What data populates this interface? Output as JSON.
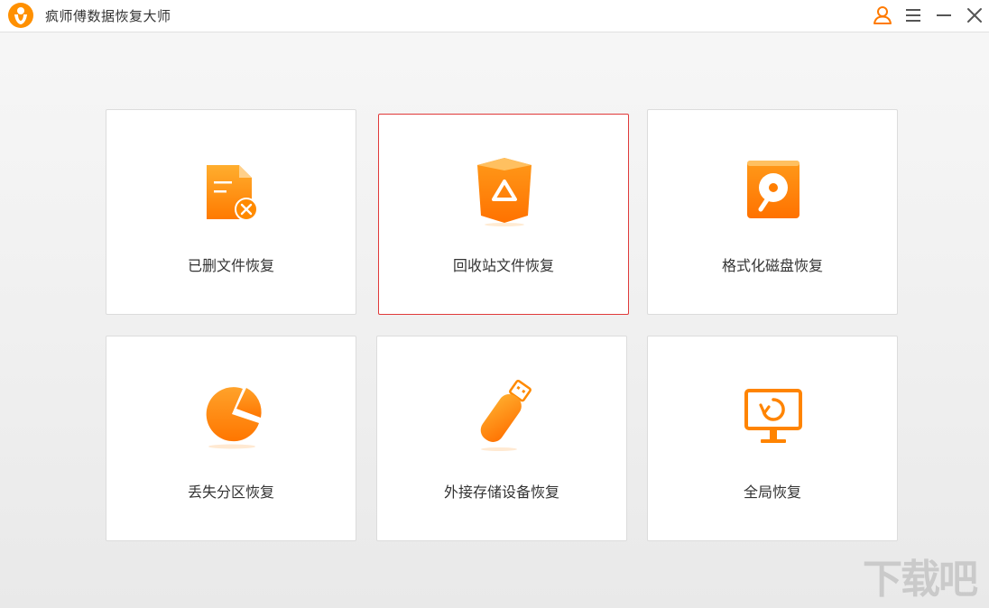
{
  "window": {
    "title": "疯师傅数据恢复大师"
  },
  "titlebar": {
    "account_icon": "user-icon",
    "menu_icon": "hamburger-menu-icon",
    "minimize_icon": "minimize-icon",
    "close_icon": "close-icon"
  },
  "cards": [
    {
      "label": "已删文件恢复",
      "icon": "deleted-file-icon"
    },
    {
      "label": "回收站文件恢复",
      "icon": "recycle-bin-icon"
    },
    {
      "label": "格式化磁盘恢复",
      "icon": "formatted-disk-icon"
    },
    {
      "label": "丢失分区恢复",
      "icon": "partition-pie-icon"
    },
    {
      "label": "外接存储设备恢复",
      "icon": "usb-drive-icon"
    },
    {
      "label": "全局恢复",
      "icon": "monitor-refresh-icon"
    }
  ],
  "selected_card": "回收站文件恢复",
  "watermark": "下载吧",
  "colors": {
    "accent": "#ff8a00",
    "accent_dark": "#f56b00",
    "selected_border": "#e03a3a"
  }
}
